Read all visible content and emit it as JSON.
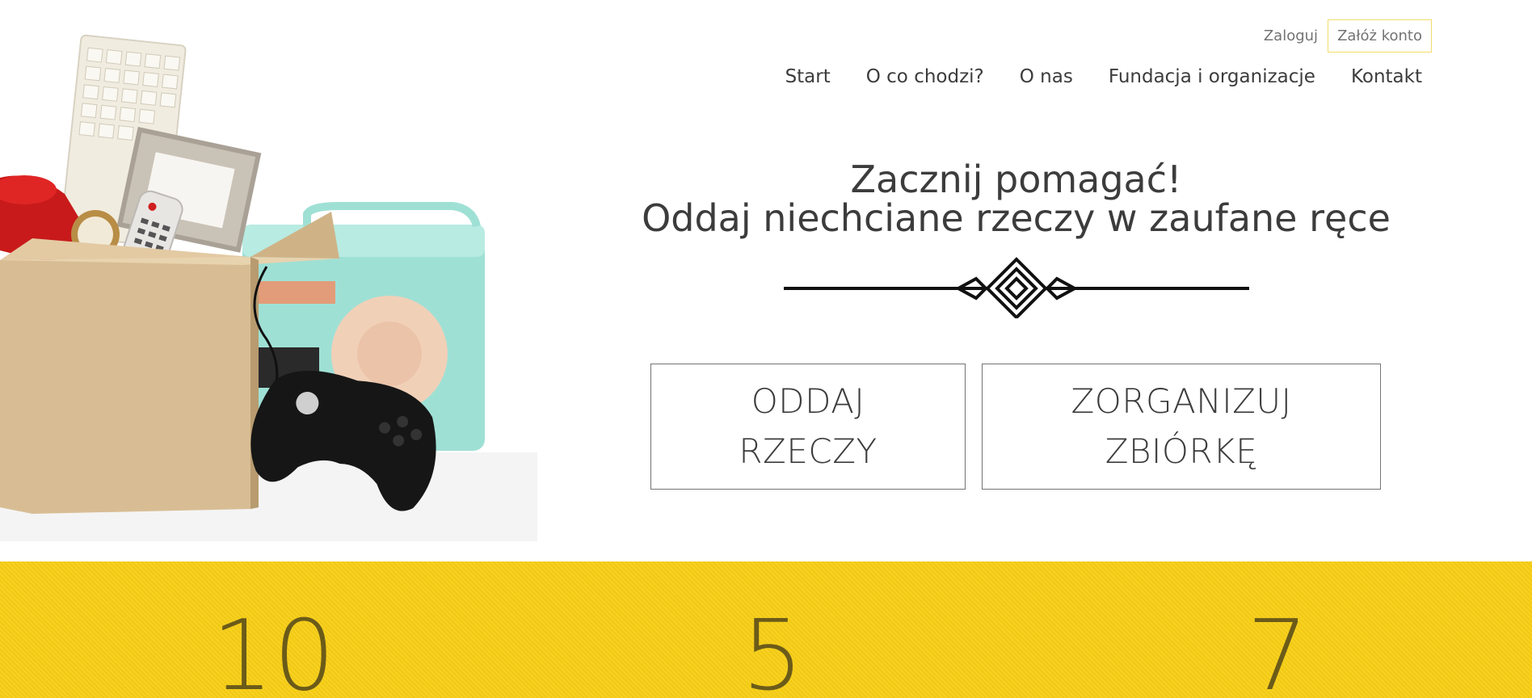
{
  "auth": {
    "login_label": "Zaloguj",
    "register_label": "Załóż konto"
  },
  "nav": {
    "items": [
      {
        "label": "Start"
      },
      {
        "label": "O co chodzi?"
      },
      {
        "label": "O nas"
      },
      {
        "label": "Fundacja i organizacje"
      },
      {
        "label": "Kontakt"
      }
    ]
  },
  "hero": {
    "headline_line1": "Zacznij pomagać!",
    "headline_line2": "Oddaj niechciane rzeczy w zaufane ręce",
    "give_button": {
      "line1": "ODDAJ",
      "line2": "RZECZY"
    },
    "organize_button": {
      "line1": "ZORGANIZUJ",
      "line2": "ZBIÓRKĘ"
    }
  },
  "stats": {
    "items": [
      {
        "value": "10"
      },
      {
        "value": "5"
      },
      {
        "value": "7"
      }
    ]
  },
  "colors": {
    "accent_yellow": "#f8cf16",
    "text_dark": "#3c3c3c",
    "stat_text": "#6b5b19",
    "register_border": "#f1dc6a"
  },
  "icons": {
    "ornament": "decorative-ornament-icon"
  }
}
